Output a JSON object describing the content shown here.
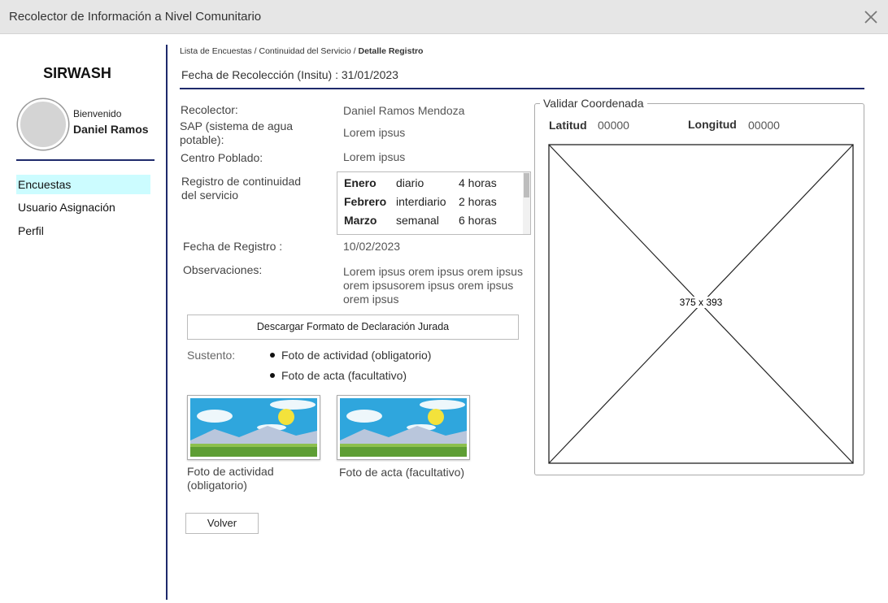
{
  "window": {
    "title": "Recolector de Información a Nivel Comunitario",
    "close_icon": "close-icon"
  },
  "sidebar": {
    "brand": "SIRWASH",
    "welcome": "Bienvenido",
    "user": "Daniel Ramos",
    "items": [
      {
        "label": "Encuestas",
        "active": true
      },
      {
        "label": "Usuario Asignación",
        "active": false
      },
      {
        "label": "Perfil",
        "active": false
      }
    ],
    "accent_color": "#1e2a6b",
    "active_bg": "#ccfcff"
  },
  "breadcrumb": {
    "items": [
      "Lista de Encuestas",
      "Continuidad del Servicio"
    ],
    "separator": "/",
    "current": "Detalle Registro"
  },
  "header": {
    "fecha_label": "Fecha de Recolección (Insitu) : 31/01/2023"
  },
  "details": {
    "recolector_label": "Recolector:",
    "recolector_value": "Daniel Ramos Mendoza",
    "sap_label": "SAP (sistema de agua potable):",
    "sap_value": "Lorem ipsus",
    "centro_label": "Centro Poblado:",
    "centro_value": "Lorem ipsus",
    "continuidad_label": "Registro de continuidad del servicio",
    "continuidad": [
      {
        "mes": "Enero",
        "frecuencia": "diario",
        "horas": "4 horas"
      },
      {
        "mes": "Febrero",
        "frecuencia": "interdiario",
        "horas": "2 horas"
      },
      {
        "mes": "Marzo",
        "frecuencia": "semanal",
        "horas": "6 horas"
      }
    ],
    "registro_label": "Fecha de Registro :",
    "registro_value": "10/02/2023",
    "observaciones_label": "Observaciones:",
    "observaciones_value": "Lorem ipsus orem ipsus orem ipsus orem ipsusorem ipsus orem ipsus orem ipsus"
  },
  "download_button": "Descargar Formato de Declaración Jurada",
  "sustento": {
    "label": "Sustento:",
    "items": [
      "Foto de actividad (obligatorio)",
      "Foto de acta (facultativo)"
    ]
  },
  "photos": [
    {
      "caption": "Foto de actividad (obligatorio)"
    },
    {
      "caption": "Foto de acta (facultativo)"
    }
  ],
  "back_button": "Volver",
  "coordinates": {
    "legend": "Validar Coordenada",
    "lat_label": "Latitud",
    "lat_value": "00000",
    "lon_label": "Longitud",
    "lon_value": "00000",
    "map_placeholder": "375 x 393"
  }
}
